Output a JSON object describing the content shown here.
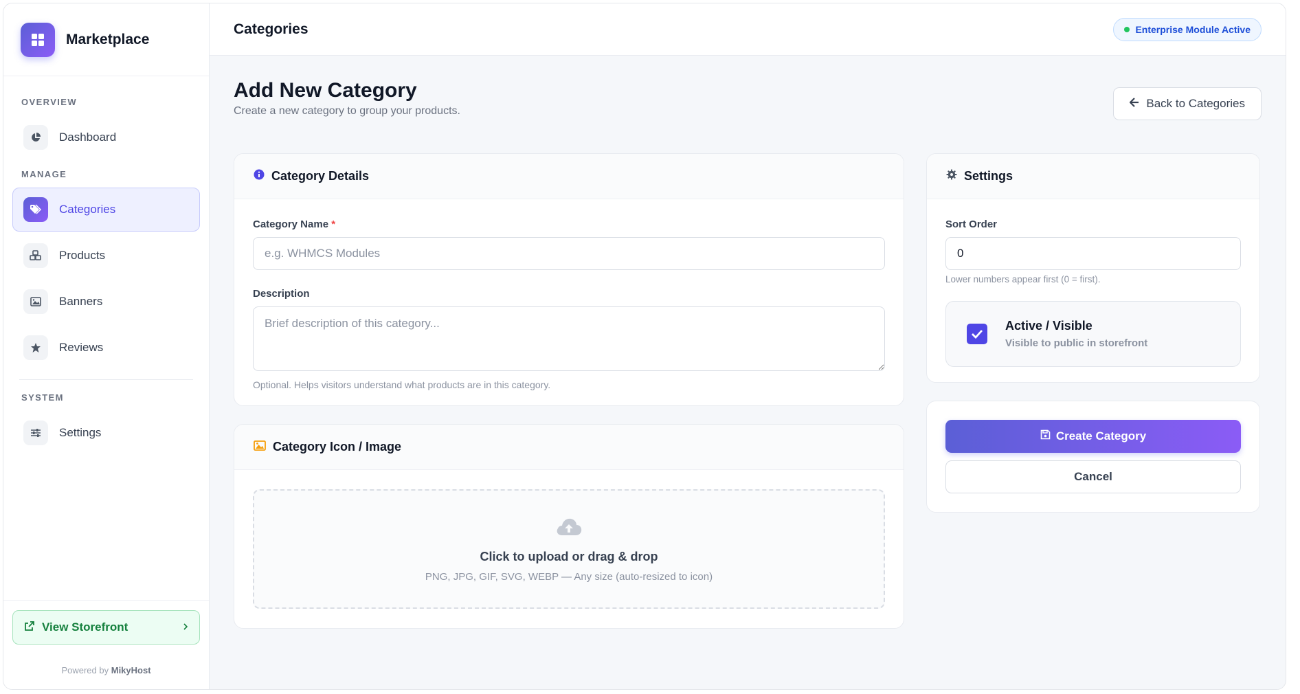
{
  "brand": {
    "name": "Marketplace",
    "icon": "grid-icon",
    "accent": "#6366f1"
  },
  "sidebar": {
    "sections": {
      "overview": "OVERVIEW",
      "manage": "MANAGE",
      "system": "SYSTEM"
    },
    "items": [
      {
        "label": "Dashboard",
        "icon": "pie-chart-icon",
        "active": false
      },
      {
        "label": "Categories",
        "icon": "tags-icon",
        "active": true
      },
      {
        "label": "Products",
        "icon": "cubes-icon",
        "active": false
      },
      {
        "label": "Banners",
        "icon": "image-icon",
        "active": false
      },
      {
        "label": "Reviews",
        "icon": "star-icon",
        "active": false
      },
      {
        "label": "Settings",
        "icon": "sliders-icon",
        "active": false
      }
    ],
    "storefront": {
      "label": "View Storefront",
      "icon": "external-link-icon"
    },
    "powered_prefix": "Powered by",
    "powered_brand": "MikyHost"
  },
  "topbar": {
    "title": "Categories",
    "badge": "Enterprise Module Active",
    "badge_color": "#1d4ed8"
  },
  "page": {
    "title": "Add New Category",
    "subtitle": "Create a new category to group your products.",
    "back_button": "Back to Categories"
  },
  "details": {
    "title": "Category Details",
    "name_label": "Category Name",
    "required_mark": "*",
    "name_value": "",
    "name_placeholder": "e.g. WHMCS Modules",
    "description_label": "Description",
    "description_value": "",
    "description_placeholder": "Brief description of this category...",
    "description_help": "Optional. Helps visitors understand what products are in this category."
  },
  "image": {
    "title": "Category Icon / Image",
    "upload_title": "Click to upload or drag & drop",
    "upload_hint": "PNG, JPG, GIF, SVG, WEBP — Any size (auto-resized to icon)"
  },
  "settings": {
    "title": "Settings",
    "sort_label": "Sort Order",
    "sort_value": "0",
    "sort_help": "Lower numbers appear first (0 = first).",
    "active_title": "Active / Visible",
    "active_sub": "Visible to public in storefront",
    "active_checked": true
  },
  "actions": {
    "create": "Create Category",
    "cancel": "Cancel"
  }
}
